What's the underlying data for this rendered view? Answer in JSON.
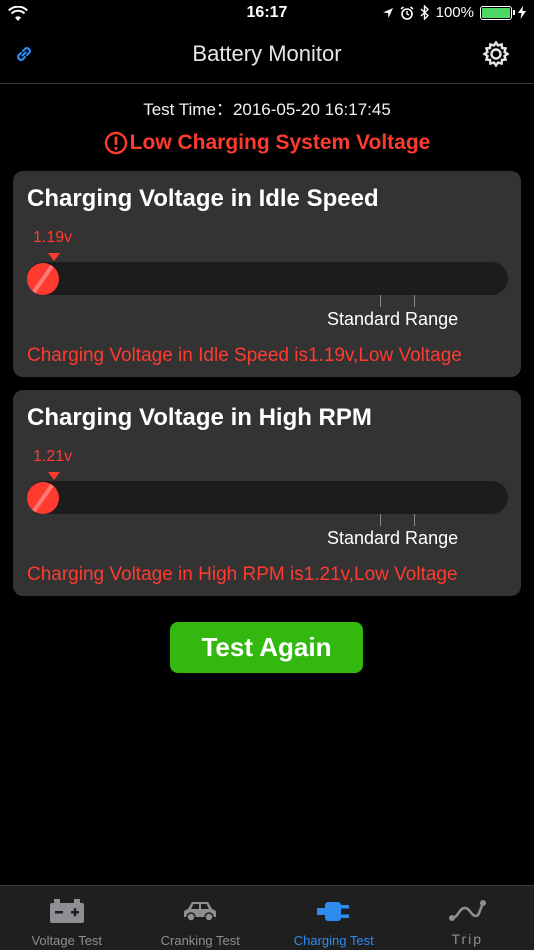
{
  "status_bar": {
    "time": "16:17",
    "battery_percent": "100%"
  },
  "nav": {
    "title": "Battery Monitor"
  },
  "test_time": {
    "label": "Test Time：",
    "value": "2016-05-20 16:17:45"
  },
  "alert": {
    "text": "Low Charging System Voltage"
  },
  "idle_card": {
    "title": "Charging Voltage in Idle Speed",
    "reading": "1.19v",
    "standard_range_label": "Standard Range",
    "verdict": "Charging Voltage in Idle Speed is1.19v,Low Voltage"
  },
  "high_card": {
    "title": "Charging Voltage in High RPM",
    "reading": "1.21v",
    "standard_range_label": "Standard Range",
    "verdict": "Charging Voltage in High RPM is1.21v,Low Voltage"
  },
  "test_again_label": "Test Again",
  "tabs": [
    {
      "label": "Voltage Test",
      "icon": "car-battery-icon",
      "active": false
    },
    {
      "label": "Cranking Test",
      "icon": "car-icon",
      "active": false
    },
    {
      "label": "Charging Test",
      "icon": "charging-plug-icon",
      "active": true
    },
    {
      "label": "Trip",
      "icon": "trip-route-icon",
      "active": false
    }
  ],
  "colors": {
    "accent": "#2d8cf0",
    "alert": "#ff3b30",
    "button": "#32b80f",
    "card": "#333333"
  }
}
